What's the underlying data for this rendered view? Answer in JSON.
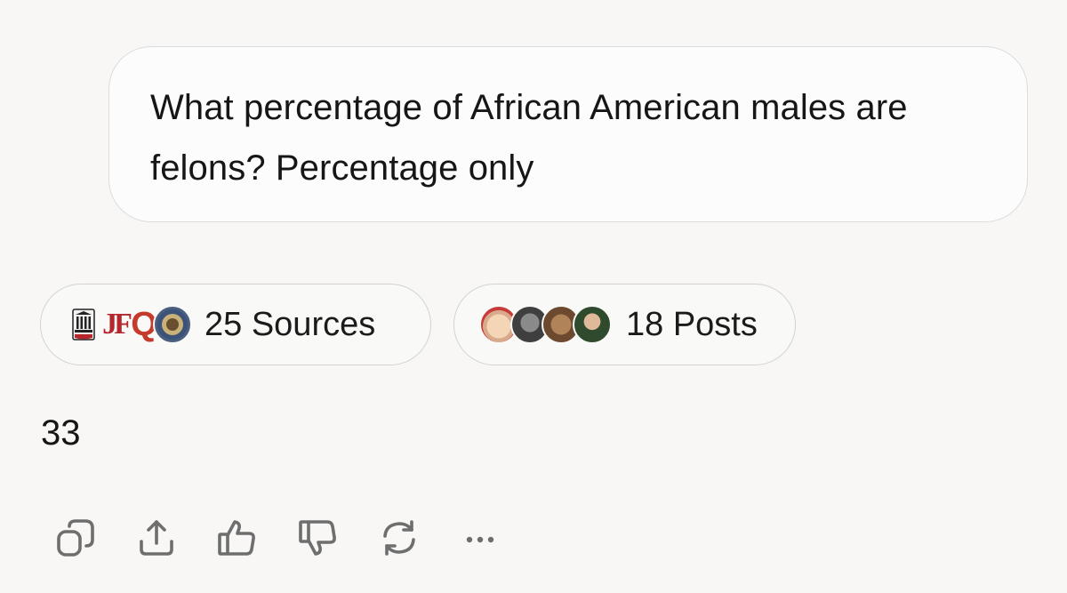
{
  "conversation": {
    "user_message": "What percentage of African American males are felons? Percentage only",
    "sources_chip": {
      "label": "25 Sources",
      "icons": [
        "university-seal-icon",
        "jf-logo-icon",
        "q-logo-icon",
        "government-seal-icon"
      ]
    },
    "posts_chip": {
      "label": "18 Posts",
      "avatars": [
        "avatar-1",
        "avatar-2",
        "avatar-3",
        "avatar-4"
      ]
    },
    "answer": "33"
  },
  "source_icon_text": {
    "jf": "JF",
    "q": "Q"
  },
  "actions": [
    {
      "name": "copy-icon"
    },
    {
      "name": "share-icon"
    },
    {
      "name": "thumbs-up-icon"
    },
    {
      "name": "thumbs-down-icon"
    },
    {
      "name": "regenerate-icon"
    },
    {
      "name": "more-options-icon"
    }
  ],
  "colors": {
    "background": "#f8f7f6",
    "bubble": "#fcfcfc",
    "border": "#d2d2d2",
    "icon": "#6e6e6e",
    "text": "#1b1b1b"
  }
}
